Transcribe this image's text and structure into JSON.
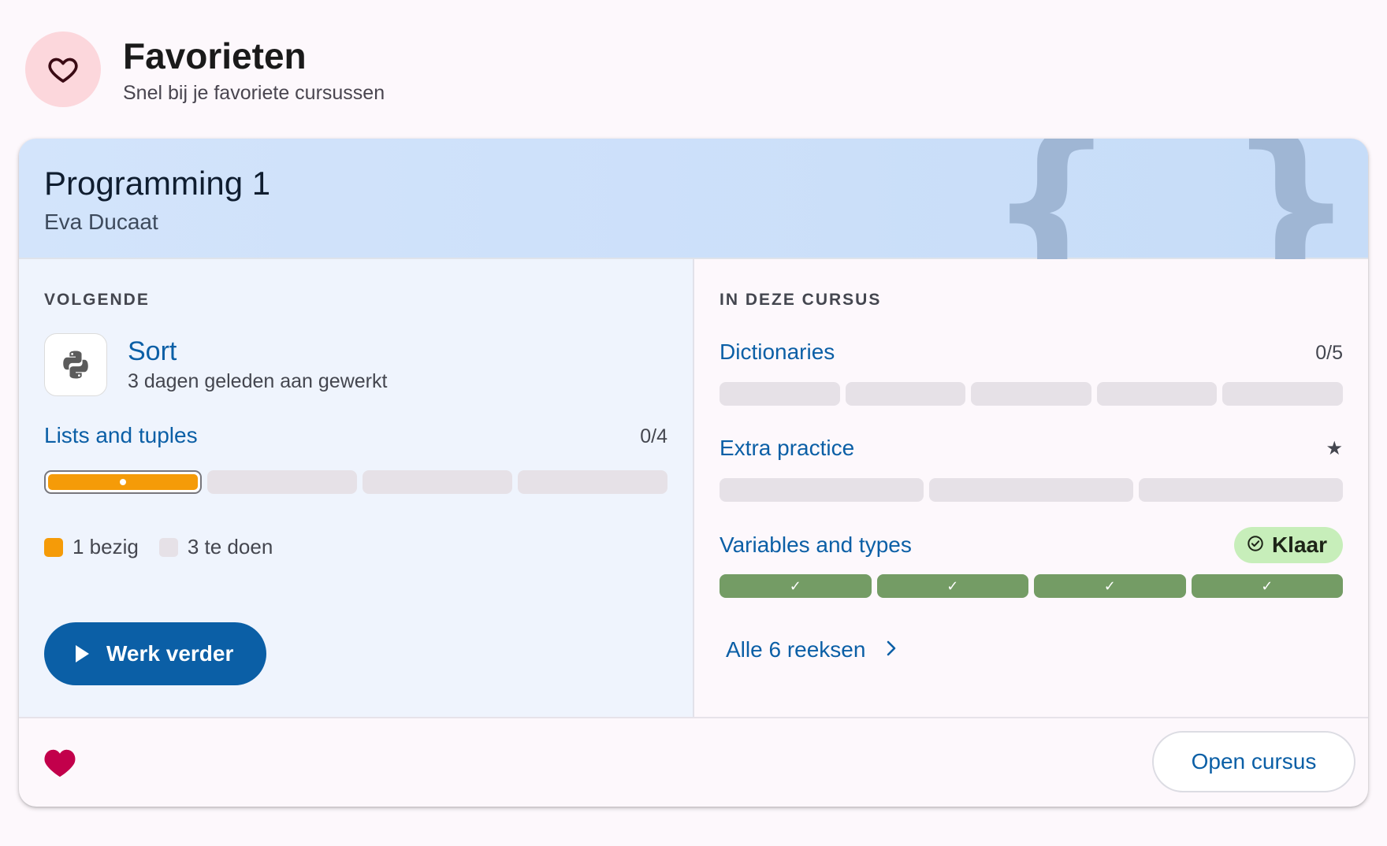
{
  "header": {
    "title": "Favorieten",
    "subtitle": "Snel bij je favoriete cursussen",
    "icon": "heart-outline-icon"
  },
  "course": {
    "title": "Programming 1",
    "teacher": "Eva Ducaat",
    "decoration": "{ }"
  },
  "next": {
    "label": "VOLGENDE",
    "activity": {
      "title": "Sort",
      "subtitle": "3 dagen geleden aan gewerkt",
      "icon": "python-icon"
    },
    "series": {
      "title": "Lists and tuples",
      "count": "0/4",
      "bars": [
        "in-progress",
        "todo",
        "todo",
        "todo"
      ]
    },
    "legend": [
      {
        "label": "1 bezig",
        "color": "#f59b08"
      },
      {
        "label": "3 te doen",
        "color": "#e6e1e7"
      }
    ],
    "continue_label": "Werk verder"
  },
  "in_course": {
    "label": "IN DEZE CURSUS",
    "series": [
      {
        "title": "Dictionaries",
        "count": "0/5",
        "bars": [
          "todo",
          "todo",
          "todo",
          "todo",
          "todo"
        ]
      },
      {
        "title": "Extra practice",
        "marker": "star-icon",
        "bars": [
          "todo",
          "todo",
          "todo"
        ]
      },
      {
        "title": "Variables and types",
        "badge": "Klaar",
        "bars": [
          "done",
          "done",
          "done",
          "done"
        ]
      }
    ],
    "all_link": "Alle 6 reeksen"
  },
  "footer": {
    "favorite_icon": "heart-filled-icon",
    "open_label": "Open cursus"
  },
  "colors": {
    "primary": "#0b5fa6",
    "in_progress": "#f59b08",
    "done": "#749c65",
    "todo": "#e6e1e7",
    "favorite": "#c2004b"
  }
}
